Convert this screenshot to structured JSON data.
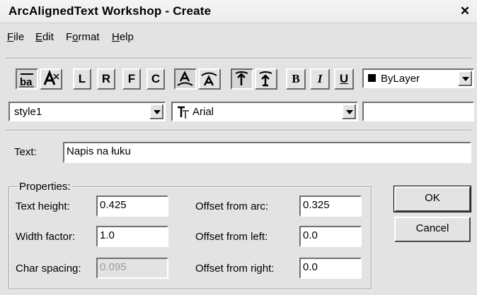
{
  "window": {
    "title": "ArcAlignedText Workshop - Create",
    "close_symbol": "✕"
  },
  "menu": [
    {
      "label": "File",
      "mnemonic": "F",
      "rest": "ile"
    },
    {
      "label": "Edit",
      "mnemonic": "E",
      "rest": "dit"
    },
    {
      "label": "Format",
      "pre": "F",
      "mnemonic": "o",
      "rest": "rmat"
    },
    {
      "label": "Help",
      "mnemonic": "H",
      "rest": "elp"
    }
  ],
  "toolbar": {
    "left_label": "L",
    "right_label": "R",
    "fit_label": "F",
    "center_label": "C",
    "bold_label": "B",
    "italic_label": "I",
    "underline_label": "U",
    "color_value": "ByLayer",
    "color_swatch": "#000000"
  },
  "style_combo": {
    "value": "style1"
  },
  "font_combo": {
    "value": "Arial",
    "icon": "truetype-font-icon"
  },
  "text_field": {
    "label": "Text:",
    "value": "Napis na łuku"
  },
  "properties": {
    "group_title": "Properties:",
    "text_height": {
      "label": "Text height:",
      "value": "0.425"
    },
    "width_factor": {
      "label": "Width factor:",
      "value": "1.0"
    },
    "char_spacing": {
      "label": "Char spacing:",
      "value": "0.095"
    },
    "offset_arc": {
      "label": "Offset from arc:",
      "value": "0.325"
    },
    "offset_left": {
      "label": "Offset from left:",
      "value": "0.0"
    },
    "offset_right": {
      "label": "Offset from right:",
      "value": "0.0"
    }
  },
  "buttons": {
    "ok": "OK",
    "cancel": "Cancel"
  }
}
